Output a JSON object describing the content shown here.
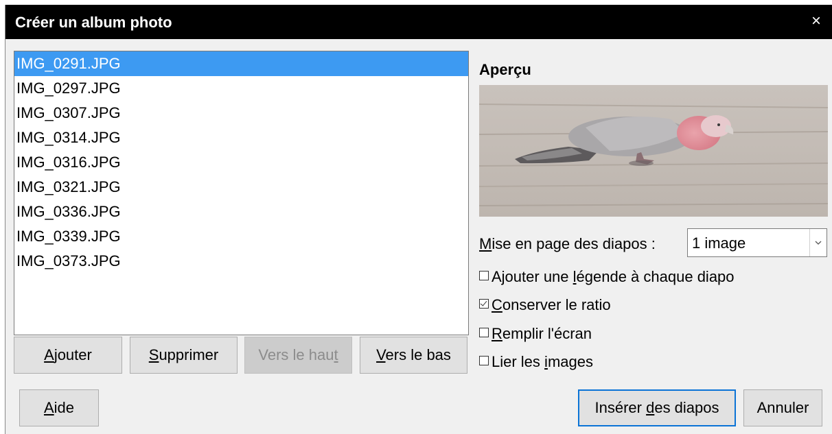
{
  "window": {
    "title": "Créer un album photo",
    "close_glyph": "×"
  },
  "files": [
    "IMG_0291.JPG",
    "IMG_0297.JPG",
    "IMG_0307.JPG",
    "IMG_0314.JPG",
    "IMG_0316.JPG",
    "IMG_0321.JPG",
    "IMG_0336.JPG",
    "IMG_0339.JPG",
    "IMG_0373.JPG"
  ],
  "selected_index": 0,
  "list_buttons": {
    "add": {
      "pre": "",
      "u": "A",
      "post": "jouter"
    },
    "remove": {
      "pre": "",
      "u": "S",
      "post": "upprimer"
    },
    "up": {
      "pre": "Vers le hau",
      "u": "t",
      "post": ""
    },
    "down": {
      "pre": "",
      "u": "V",
      "post": "ers le bas"
    }
  },
  "preview": {
    "label": "Aperçu"
  },
  "layout": {
    "label_u": "M",
    "label_rest": "ise en page des diapos :",
    "value": "1 image"
  },
  "options": [
    {
      "pre": "Ajouter une ",
      "u": "l",
      "post": "égende à chaque diapo",
      "checked": false
    },
    {
      "pre": "",
      "u": "C",
      "post": "onserver le ratio",
      "checked": true
    },
    {
      "pre": "",
      "u": "R",
      "post": "emplir l'écran",
      "checked": false
    },
    {
      "pre": "Lier les ",
      "u": "i",
      "post": "mages",
      "checked": false
    }
  ],
  "footer": {
    "help": {
      "pre": "",
      "u": "A",
      "post": "ide"
    },
    "insert": {
      "pre": "Insérer ",
      "u": "d",
      "post": "es diapos"
    },
    "cancel": {
      "label": "Annuler"
    }
  },
  "colors": {
    "selection": "#3d9af2",
    "titlebar": "#000000",
    "dialog_bg": "#f0f0f0"
  }
}
